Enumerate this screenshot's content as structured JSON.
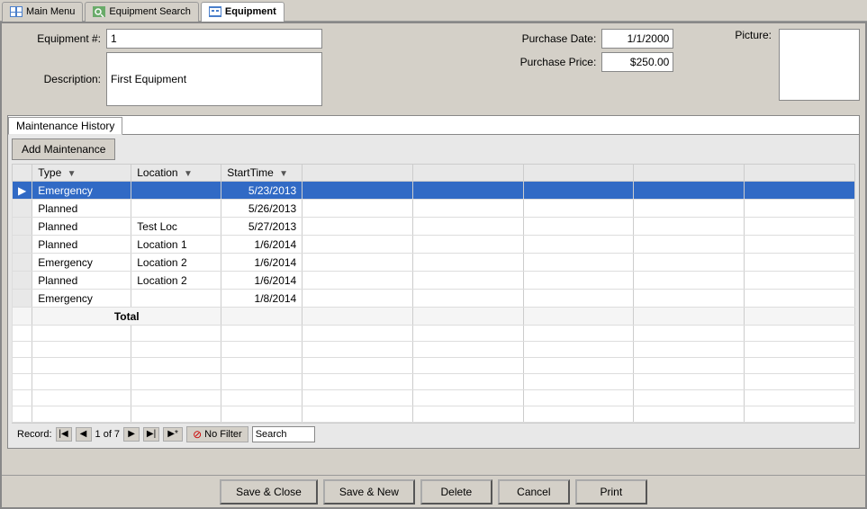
{
  "tabs": [
    {
      "id": "main-menu",
      "label": "Main Menu",
      "icon": "main-icon",
      "active": false
    },
    {
      "id": "equipment-search",
      "label": "Equipment Search",
      "icon": "search-icon",
      "active": false
    },
    {
      "id": "equipment",
      "label": "Equipment",
      "icon": "equip-icon",
      "active": true
    }
  ],
  "form": {
    "equipment_num_label": "Equipment #:",
    "equipment_num_value": "1",
    "description_label": "Description:",
    "description_value": "First Equipment",
    "purchase_date_label": "Purchase Date:",
    "purchase_date_value": "1/1/2000",
    "purchase_price_label": "Purchase Price:",
    "purchase_price_value": "$250.00",
    "picture_label": "Picture:"
  },
  "maintenance": {
    "tab_label": "Maintenance History",
    "add_button": "Add Maintenance",
    "columns": [
      {
        "id": "type",
        "label": "Type",
        "sort": "▼"
      },
      {
        "id": "location",
        "label": "Location",
        "sort": "▼"
      },
      {
        "id": "starttime",
        "label": "StartTime",
        "sort": "▼"
      }
    ],
    "rows": [
      {
        "indicator": "▶",
        "type": "Emergency",
        "location": "",
        "starttime": "5/23/2013",
        "selected": true
      },
      {
        "indicator": "",
        "type": "Planned",
        "location": "",
        "starttime": "5/26/2013",
        "selected": false
      },
      {
        "indicator": "",
        "type": "Planned",
        "location": "Test Loc",
        "starttime": "5/27/2013",
        "selected": false
      },
      {
        "indicator": "",
        "type": "Planned",
        "location": "Location 1",
        "starttime": "1/6/2014",
        "selected": false
      },
      {
        "indicator": "",
        "type": "Emergency",
        "location": "Location 2",
        "starttime": "1/6/2014",
        "selected": false
      },
      {
        "indicator": "",
        "type": "Planned",
        "location": "Location 2",
        "starttime": "1/6/2014",
        "selected": false
      },
      {
        "indicator": "",
        "type": "Emergency",
        "location": "",
        "starttime": "1/8/2014",
        "selected": false
      }
    ],
    "total_label": "Total"
  },
  "record_nav": {
    "record_label": "Record:",
    "current": "1 of 7",
    "no_filter_label": "No Filter",
    "search_placeholder": "Search",
    "nav_first": "◀◀",
    "nav_prev": "◀",
    "nav_next": "▶",
    "nav_last": "▶▶",
    "nav_new": "▶*"
  },
  "buttons": {
    "save_close": "Save & Close",
    "save_new": "Save & New",
    "delete": "Delete",
    "cancel": "Cancel",
    "print": "Print"
  }
}
